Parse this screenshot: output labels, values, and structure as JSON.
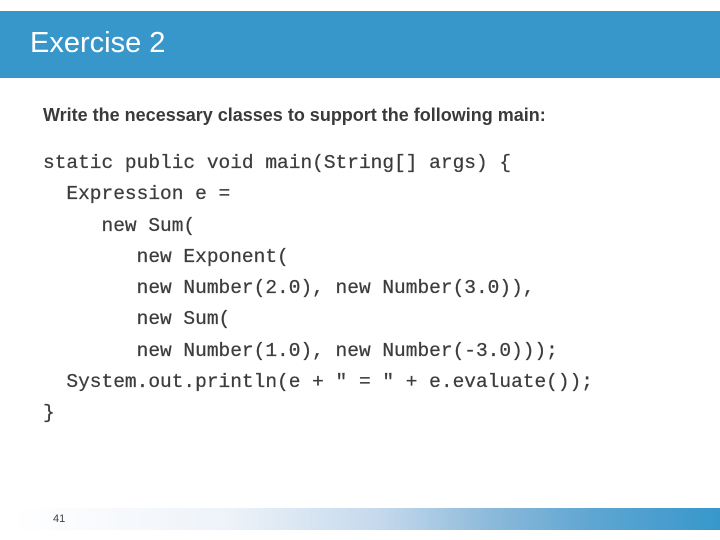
{
  "slide": {
    "title": "Exercise 2",
    "instruction": "Write the necessary classes to support the following main:",
    "code_lines": [
      "static public void main(String[] args) {",
      "  Expression e =",
      "     new Sum(",
      "        new Exponent(",
      "        new Number(2.0), new Number(3.0)),",
      "        new Sum(",
      "        new Number(1.0), new Number(-3.0)));",
      "  System.out.println(e + \" = \" + e.evaluate());",
      "}"
    ],
    "page_number": "41"
  },
  "colors": {
    "header_background": "#3797cb",
    "title_text": "#ffffff",
    "body_text": "#3a3a3a"
  }
}
